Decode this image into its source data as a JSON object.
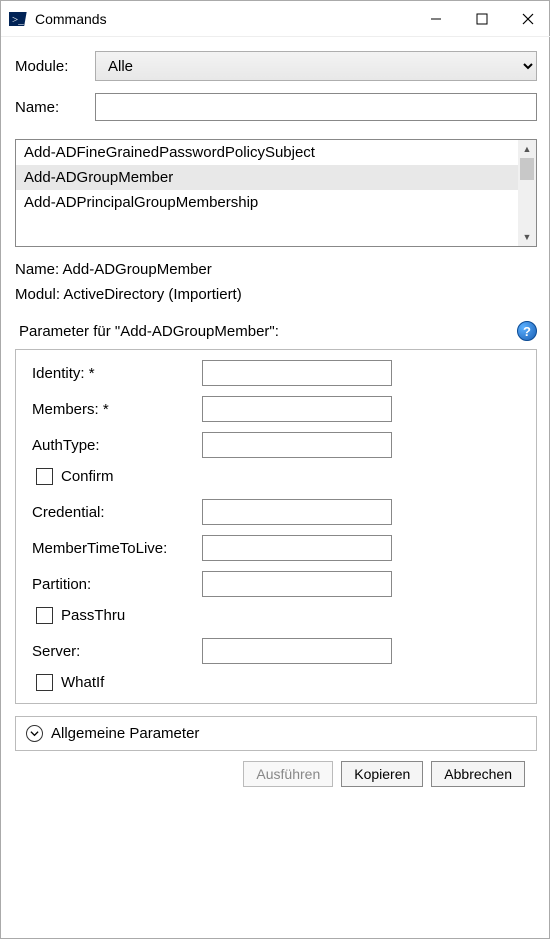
{
  "window": {
    "title": "Commands"
  },
  "filters": {
    "module_label": "Module:",
    "module_value": "Alle",
    "name_label": "Name:",
    "name_value": ""
  },
  "command_list": {
    "items": [
      "Add-ADFineGrainedPasswordPolicySubject",
      "Add-ADGroupMember",
      "Add-ADPrincipalGroupMembership"
    ],
    "selected_index": 1
  },
  "selection_info": {
    "name_line": "Name: Add-ADGroupMember",
    "module_line": "Modul: ActiveDirectory (Importiert)"
  },
  "parameters": {
    "header": "Parameter für \"Add-ADGroupMember\":",
    "fields": [
      {
        "label": "Identity: *",
        "type": "text",
        "value": ""
      },
      {
        "label": "Members: *",
        "type": "text",
        "value": ""
      },
      {
        "label": "AuthType:",
        "type": "text",
        "value": ""
      },
      {
        "label": "Confirm",
        "type": "checkbox",
        "checked": false
      },
      {
        "label": "Credential:",
        "type": "text",
        "value": ""
      },
      {
        "label": "MemberTimeToLive:",
        "type": "text",
        "value": ""
      },
      {
        "label": "Partition:",
        "type": "text",
        "value": ""
      },
      {
        "label": "PassThru",
        "type": "checkbox",
        "checked": false
      },
      {
        "label": "Server:",
        "type": "text",
        "value": ""
      },
      {
        "label": "WhatIf",
        "type": "checkbox",
        "checked": false
      }
    ],
    "expander_label": "Allgemeine Parameter"
  },
  "buttons": {
    "run": "Ausführen",
    "copy": "Kopieren",
    "cancel": "Abbrechen",
    "run_enabled": false
  }
}
